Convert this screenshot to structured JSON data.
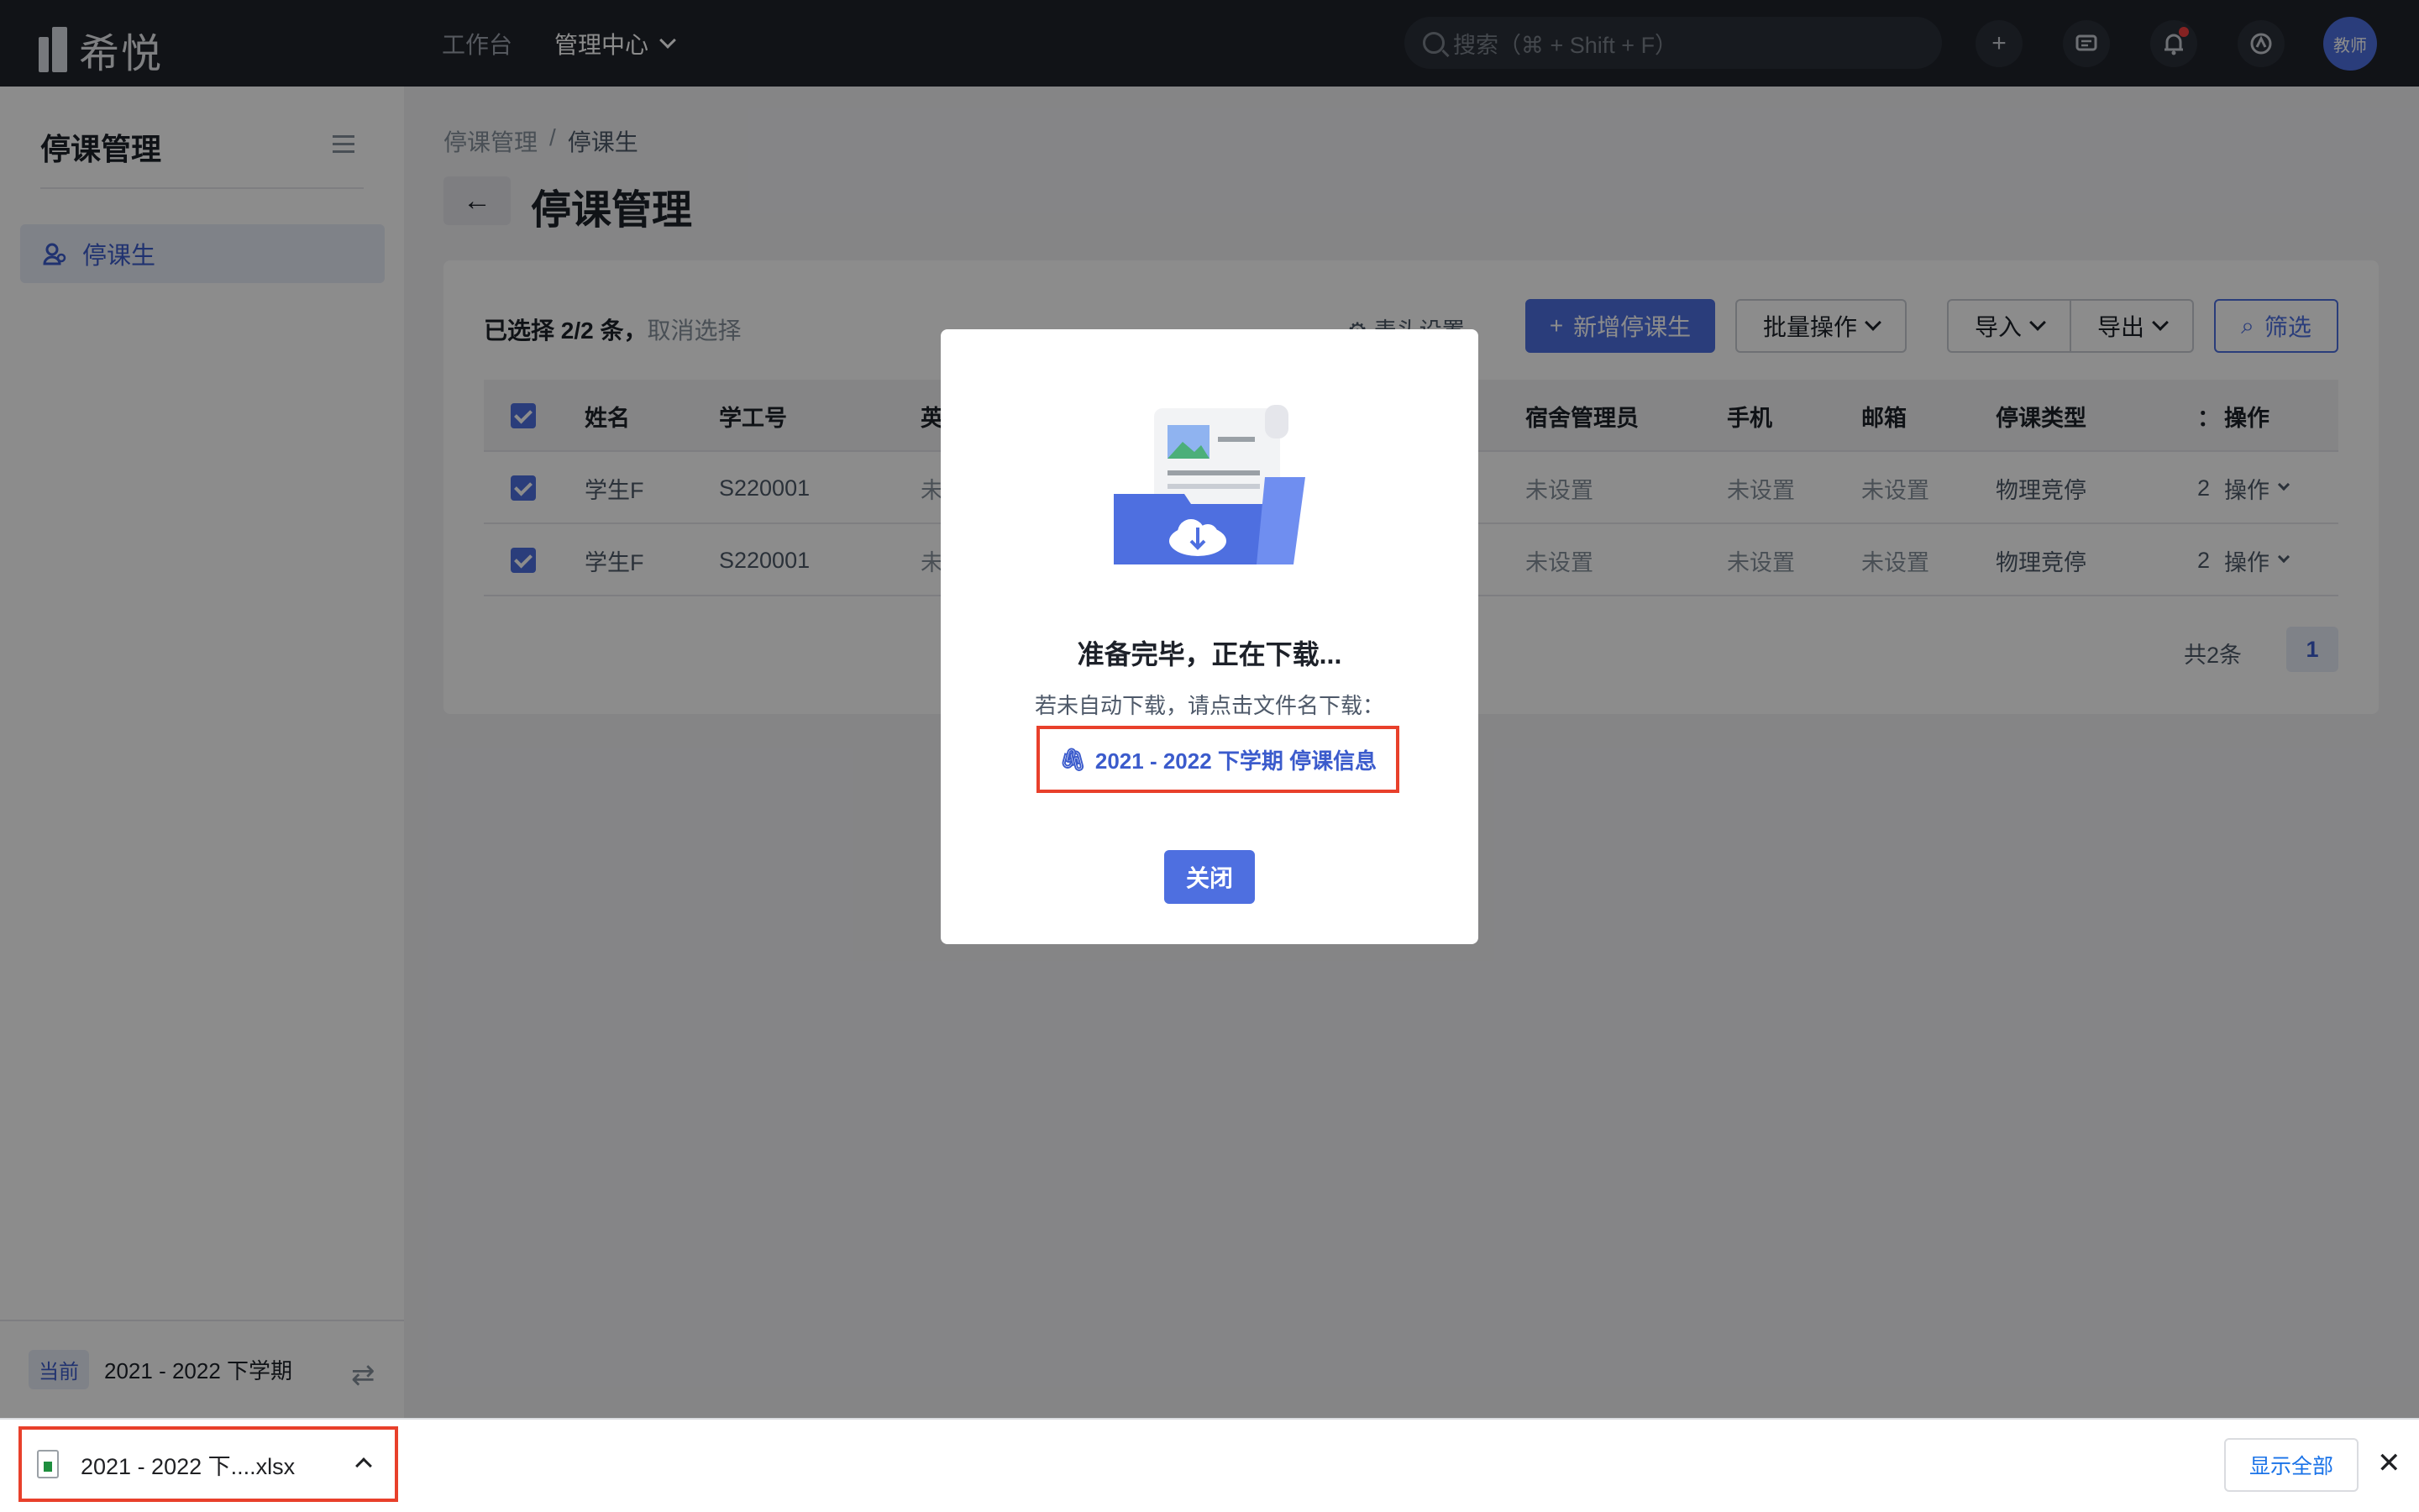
{
  "topbar": {
    "logo": "希悦",
    "nav": [
      "工作台",
      "管理中心"
    ],
    "search_placeholder": "搜索（⌘ + Shift + F）",
    "avatar_text": "教师"
  },
  "sidebar": {
    "title": "停课管理",
    "items": [
      {
        "label": "停课生"
      }
    ],
    "footer": {
      "tag": "当前",
      "term": "2021 - 2022 下学期"
    }
  },
  "breadcrumb": [
    "停课管理",
    "停课生"
  ],
  "page_title": "停课管理",
  "toolbar": {
    "selection": "已选择 2/2 条，",
    "cancel": "取消选择",
    "header_settings": "表头设置",
    "add": "新增停课生",
    "batch": "批量操作",
    "import": "导入",
    "export": "导出",
    "filter": "筛选"
  },
  "table": {
    "columns": [
      "姓名",
      "学工号",
      "英",
      "宿舍管理员",
      "手机",
      "邮箱",
      "停课类型",
      "：",
      "操作"
    ],
    "rows": [
      {
        "name": "学生F",
        "id": "S220001",
        "col3": "未",
        "dorm": "未设置",
        "phone": "未设置",
        "email": "未设置",
        "type": "物理竞停",
        "extra": "2",
        "action": "操作"
      },
      {
        "name": "学生F",
        "id": "S220001",
        "col3": "未",
        "dorm": "未设置",
        "phone": "未设置",
        "email": "未设置",
        "type": "物理竞停",
        "extra": "2",
        "action": "操作"
      }
    ],
    "total": "共2条",
    "page": "1"
  },
  "modal": {
    "title": "准备完毕，正在下载...",
    "desc": "若未自动下载，请点击文件名下载：",
    "file_link": "2021 - 2022 下学期 停课信息",
    "close": "关闭"
  },
  "download_bar": {
    "file": "2021 - 2022 下....xlsx",
    "show_all": "显示全部"
  },
  "colors": {
    "primary": "#4e6fe0",
    "topbar": "#1f232b",
    "highlight": "#e8402b"
  }
}
